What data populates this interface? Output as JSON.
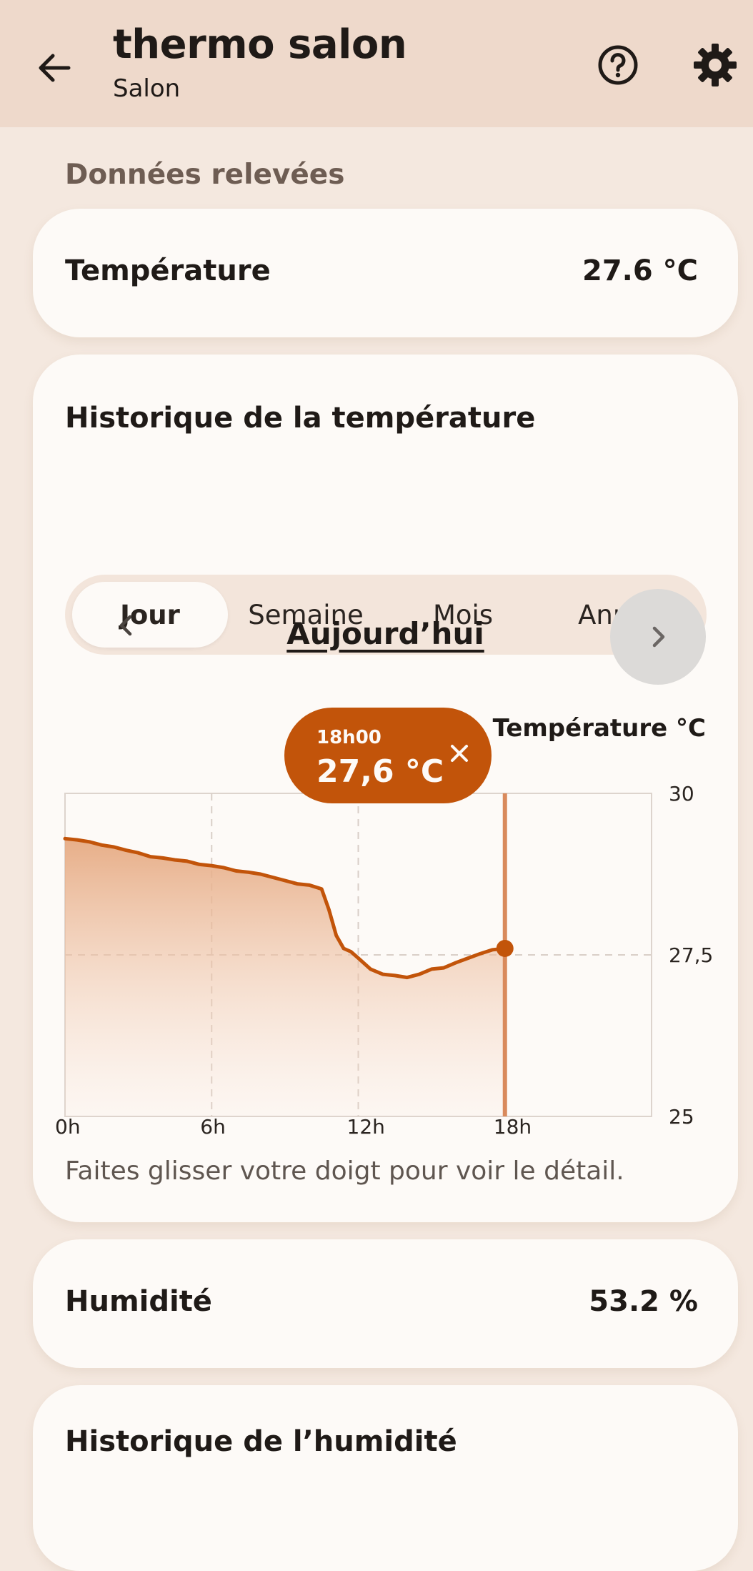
{
  "appbar": {
    "title": "thermo salon",
    "subtitle": "Salon",
    "back_icon": "arrow-left-icon",
    "help_icon": "help-circle-icon",
    "settings_icon": "gear-icon"
  },
  "section": {
    "header": "Données relevées"
  },
  "temperature": {
    "label": "Température",
    "value": "27.6 °C"
  },
  "temperature_history": {
    "title": "Historique de la température",
    "tabs": [
      {
        "label": "Jour",
        "selected": true
      },
      {
        "label": "Semaine",
        "selected": false
      },
      {
        "label": "Mois",
        "selected": false
      },
      {
        "label": "Année",
        "selected": false
      }
    ],
    "period_label": "Aujourd’hui",
    "prev_icon": "chevron-left-icon",
    "next_icon": "chevron-right-icon",
    "hint": "Faites glisser votre doigt pour voir le détail."
  },
  "humidity": {
    "label": "Humidité",
    "value": "53.2 %"
  },
  "humidity_history": {
    "title": "Historique de l’humidité"
  },
  "colors": {
    "background": "#f4e8df",
    "appbar": "#eed9cb",
    "card": "#fdfaf7",
    "accent": "#c2540a",
    "fill_top": "#e6aa82",
    "grid": "#ddd4cd"
  },
  "chart_data": {
    "type": "area",
    "series_label": "Température °C",
    "x_ticks": [
      "0h",
      "6h",
      "12h",
      "18h"
    ],
    "y_ticks": [
      "30",
      "27,5",
      "25"
    ],
    "xlim": [
      0,
      24
    ],
    "ylim": [
      25,
      30
    ],
    "x": [
      0,
      0.5,
      1,
      1.5,
      2,
      2.5,
      3,
      3.5,
      4,
      4.5,
      5,
      5.5,
      6,
      6.5,
      7,
      7.5,
      8,
      8.5,
      9,
      9.5,
      10,
      10.5,
      10.8,
      11.1,
      11.4,
      11.7,
      12,
      12.5,
      13,
      13.5,
      14,
      14.5,
      15,
      15.5,
      16,
      16.5,
      17,
      17.5,
      18
    ],
    "y": [
      29.3,
      29.28,
      29.25,
      29.2,
      29.17,
      29.12,
      29.08,
      29.02,
      29.0,
      28.97,
      28.95,
      28.9,
      28.88,
      28.85,
      28.8,
      28.78,
      28.75,
      28.7,
      28.65,
      28.6,
      28.58,
      28.52,
      28.2,
      27.8,
      27.6,
      27.55,
      27.45,
      27.28,
      27.2,
      27.18,
      27.15,
      27.2,
      27.28,
      27.3,
      27.38,
      27.45,
      27.52,
      27.58,
      27.6
    ],
    "tooltip": {
      "time": "18h00",
      "value": "27,6 °C",
      "close_icon": "close-icon"
    },
    "selected_x": 18
  }
}
